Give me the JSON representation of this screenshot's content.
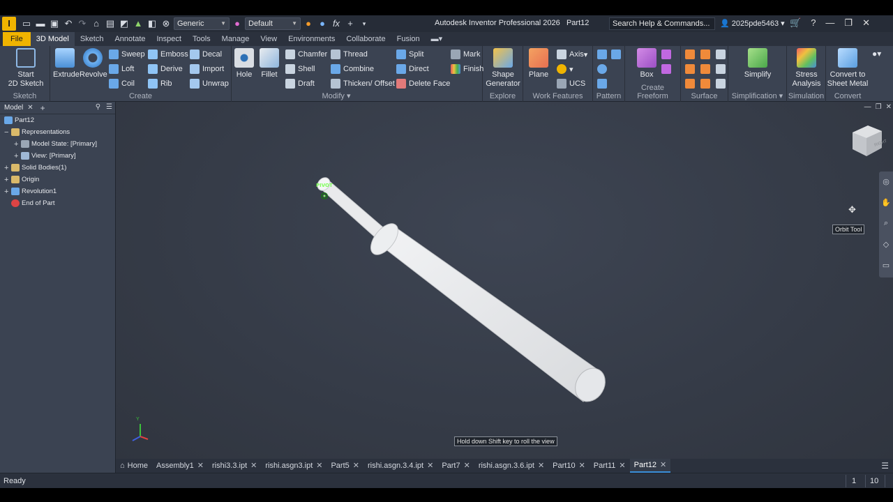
{
  "titlebar": {
    "style_combo": "Generic",
    "appearance_combo": "Default",
    "app_title": "Autodesk Inventor Professional 2026",
    "doc_name": "Part12",
    "search_placeholder": "Search Help & Commands...",
    "user": "2025pde5463"
  },
  "ribbon_tabs": [
    "File",
    "3D Model",
    "Sketch",
    "Annotate",
    "Inspect",
    "Tools",
    "Manage",
    "View",
    "Environments",
    "Collaborate",
    "Fusion"
  ],
  "active_tab": "3D Model",
  "ribbon": {
    "sketch": {
      "label": "Sketch",
      "start_line1": "Start",
      "start_line2": "2D Sketch"
    },
    "create": {
      "label": "Create",
      "extrude": "Extrude",
      "revolve": "Revolve",
      "sweep": "Sweep",
      "loft": "Loft",
      "coil": "Coil",
      "emboss": "Emboss",
      "derive": "Derive",
      "rib": "Rib",
      "decal": "Decal",
      "import": "Import",
      "unwrap": "Unwrap"
    },
    "modify": {
      "label": "Modify",
      "hole": "Hole",
      "fillet": "Fillet",
      "chamfer": "Chamfer",
      "shell": "Shell",
      "draft": "Draft",
      "thread": "Thread",
      "combine": "Combine",
      "thicken": "Thicken/ Offset",
      "split": "Split",
      "direct": "Direct",
      "delete_face": "Delete Face"
    },
    "mark": {
      "mark": "Mark",
      "finish": "Finish"
    },
    "explore": {
      "label": "Explore",
      "shape_line1": "Shape",
      "shape_line2": "Generator"
    },
    "work_features": {
      "label": "Work Features",
      "plane": "Plane",
      "axis": "Axis",
      "ucs": "UCS"
    },
    "pattern": {
      "label": "Pattern"
    },
    "freeform": {
      "label": "Create Freeform",
      "box": "Box"
    },
    "surface": {
      "label": "Surface"
    },
    "simplification": {
      "label": "Simplification",
      "simplify": "Simplify"
    },
    "simulation": {
      "label": "Simulation",
      "stress_line1": "Stress",
      "stress_line2": "Analysis"
    },
    "convert": {
      "label": "Convert",
      "line1": "Convert to",
      "line2": "Sheet Metal"
    }
  },
  "browser": {
    "tab": "Model",
    "items": [
      {
        "label": "Part12"
      },
      {
        "label": "Representations"
      },
      {
        "label": "Model State: [Primary]"
      },
      {
        "label": "View: [Primary]"
      },
      {
        "label": "Solid Bodies(1)"
      },
      {
        "label": "Origin"
      },
      {
        "label": "Revolution1"
      },
      {
        "label": "End of Part"
      }
    ]
  },
  "viewport": {
    "pivot_label": "PIVOT",
    "viewcube_face": "RIGHT",
    "orbit_tooltip": "Orbit Tool",
    "hint": "Hold down Shift key to roll the view",
    "triad_y": "Y"
  },
  "doc_tabs": {
    "home": "Home",
    "tabs": [
      "Assembly1",
      "rishi3.3.ipt",
      "rishi.asgn3.ipt",
      "Part5",
      "rishi.asgn.3.4.ipt",
      "Part7",
      "rishi.asgn.3.6.ipt",
      "Part10",
      "Part11",
      "Part12"
    ],
    "active": "Part12"
  },
  "status": {
    "text": "Ready",
    "num1": "1",
    "num2": "10"
  },
  "colors": {
    "accent": "#f0b400",
    "active_tab_underline": "#3b8fd9",
    "pivot": "#7fff5a"
  }
}
